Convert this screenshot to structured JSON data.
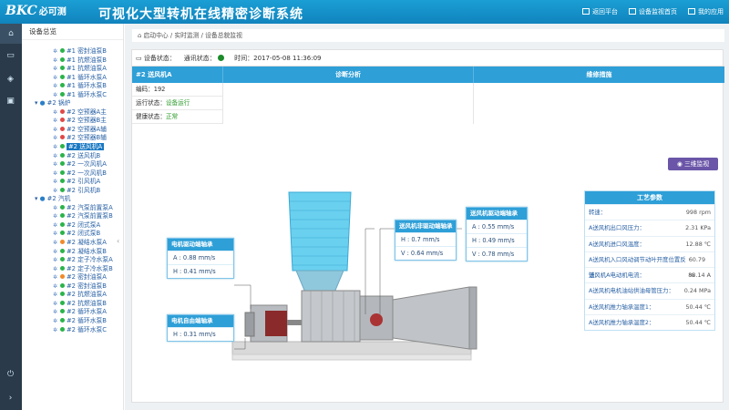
{
  "header": {
    "logo_latin": "BKC",
    "logo_cn": "必可测",
    "title": "可视化大型转机在线精密诊断系统",
    "links": [
      "返回平台",
      "设备监视首页",
      "我的应用"
    ]
  },
  "tree": {
    "title": "设备总览",
    "items": [
      {
        "label": "#1 密封油泵B",
        "dot": "#2bb34a",
        "level": 2
      },
      {
        "label": "#1 抗燃油泵B",
        "dot": "#2bb34a",
        "level": 2
      },
      {
        "label": "#1 抗燃油泵A",
        "dot": "#2bb34a",
        "level": 2
      },
      {
        "label": "#1 循环水泵A",
        "dot": "#2bb34a",
        "level": 2
      },
      {
        "label": "#1 循环水泵B",
        "dot": "#2bb34a",
        "level": 2
      },
      {
        "label": "#1 循环水泵C",
        "dot": "#2bb34a",
        "level": 2
      },
      {
        "label": "#2 锅炉",
        "dot": "",
        "level": 1
      },
      {
        "label": "#2 空预器A主",
        "dot": "#e04848",
        "level": 2
      },
      {
        "label": "#2 空预器B主",
        "dot": "#e04848",
        "level": 2
      },
      {
        "label": "#2 空预器A辅",
        "dot": "#e04848",
        "level": 2
      },
      {
        "label": "#2 空预器B辅",
        "dot": "#e04848",
        "level": 2
      },
      {
        "label": "#2 送风机A",
        "dot": "#2bb34a",
        "level": 2,
        "selected": true
      },
      {
        "label": "#2 送风机B",
        "dot": "#2bb34a",
        "level": 2
      },
      {
        "label": "#2 一次风机A",
        "dot": "#2bb34a",
        "level": 2
      },
      {
        "label": "#2 一次风机B",
        "dot": "#2bb34a",
        "level": 2
      },
      {
        "label": "#2 引风机A",
        "dot": "#2bb34a",
        "level": 2
      },
      {
        "label": "#2 引风机B",
        "dot": "#2bb34a",
        "level": 2
      },
      {
        "label": "#2 汽机",
        "dot": "",
        "level": 1
      },
      {
        "label": "#2 汽泵前置泵A",
        "dot": "#2bb34a",
        "level": 2
      },
      {
        "label": "#2 汽泵前置泵B",
        "dot": "#2bb34a",
        "level": 2
      },
      {
        "label": "#2 闭式泵A",
        "dot": "#2bb34a",
        "level": 2
      },
      {
        "label": "#2 闭式泵B",
        "dot": "#2bb34a",
        "level": 2
      },
      {
        "label": "#2 凝结水泵A",
        "dot": "#f08a2a",
        "level": 2
      },
      {
        "label": "#2 凝结水泵B",
        "dot": "#2bb34a",
        "level": 2
      },
      {
        "label": "#2 定子冷水泵A",
        "dot": "#2bb34a",
        "level": 2
      },
      {
        "label": "#2 定子冷水泵B",
        "dot": "#2bb34a",
        "level": 2
      },
      {
        "label": "#2 密封油泵A",
        "dot": "#f08a2a",
        "level": 2
      },
      {
        "label": "#2 密封油泵B",
        "dot": "#2bb34a",
        "level": 2
      },
      {
        "label": "#2 抗燃油泵A",
        "dot": "#2bb34a",
        "level": 2
      },
      {
        "label": "#2 抗燃油泵B",
        "dot": "#2bb34a",
        "level": 2
      },
      {
        "label": "#2 循环水泵A",
        "dot": "#2bb34a",
        "level": 2
      },
      {
        "label": "#2 循环水泵B",
        "dot": "#2bb34a",
        "level": 2
      },
      {
        "label": "#2 循环水泵C",
        "dot": "#2bb34a",
        "level": 2
      }
    ]
  },
  "breadcrumb": [
    "启动中心",
    "实时监测",
    "设备总貌监视"
  ],
  "status": {
    "device_label": "设备状态：",
    "comm_label": "通讯状态：",
    "time_label": "时间：",
    "time_value": "2017-05-08 11:36:09"
  },
  "table": {
    "device_name": "#2 送风机A",
    "col_diag": "诊断分析",
    "col_maint": "维修措施",
    "code": "编码：192",
    "run_label": "运行状态：",
    "run_value": "设备运行",
    "health_label": "健康状态：",
    "health_value": "正常"
  },
  "button_3d": "三维监视",
  "sensors": {
    "motor_drive": {
      "title": "电机驱动端轴承",
      "a": "A : 0.88 mm/s",
      "h": "H : 0.41 mm/s"
    },
    "motor_free": {
      "title": "电机自由端轴承",
      "h": "H : 0.31 mm/s"
    },
    "fan_nondrive": {
      "title": "送风机非驱动端轴承",
      "h": "H : 0.7 mm/s",
      "v": "V : 0.64 mm/s"
    },
    "fan_drive": {
      "title": "送风机驱动端轴承",
      "a": "A : 0.55 mm/s",
      "h": "H : 0.49 mm/s",
      "v": "V : 0.78 mm/s"
    }
  },
  "process": {
    "title": "工艺参数",
    "rows": [
      {
        "k": "转速：",
        "v": "998 rpm"
      },
      {
        "k": "A送风机出口风压力：",
        "v": "2.31 KPa"
      },
      {
        "k": "A送风机进口风温度：",
        "v": "12.88 ℃"
      },
      {
        "k": "A送风机入口风动调节动叶开度位置反馈：",
        "v": "60.79 %"
      },
      {
        "k": "送风机A电动机电流：",
        "v": "88.14 A"
      },
      {
        "k": "A送风机电机油站供油母管压力：",
        "v": "0.24 MPa"
      },
      {
        "k": "A送风机推力轴承温度1：",
        "v": "50.44 ℃"
      },
      {
        "k": "A送风机推力轴承温度2：",
        "v": "50.44 ℃"
      }
    ]
  }
}
